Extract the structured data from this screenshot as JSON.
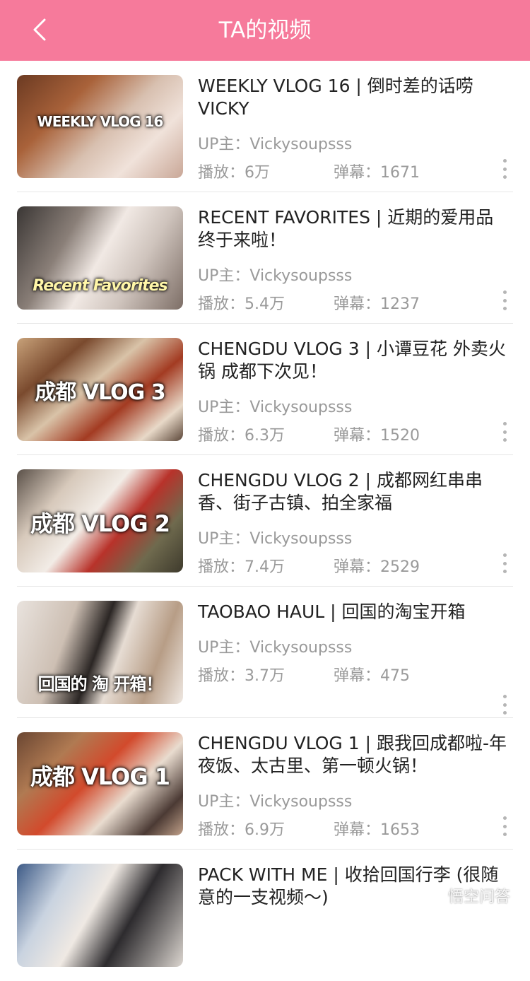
{
  "header": {
    "title": "TA的视频"
  },
  "labels": {
    "up": "UP主：",
    "play": "播放：",
    "danmu": "弹幕："
  },
  "videos": [
    {
      "title": "WEEKLY VLOG 16 | 倒时差的话唠VICKY",
      "up": "Vickysoupsss",
      "play": "6万",
      "danmu": "1671",
      "thumb_text": "WEEKLY VLOG 16"
    },
    {
      "title": "RECENT FAVORITES | 近期的爱用品终于来啦！",
      "up": "Vickysoupsss",
      "play": "5.4万",
      "danmu": "1237",
      "thumb_text": "Recent Favorites"
    },
    {
      "title": "CHENGDU VLOG 3 | 小谭豆花 外卖火锅 成都下次见！",
      "up": "Vickysoupsss",
      "play": "6.3万",
      "danmu": "1520",
      "thumb_text": "成都 VLOG 3"
    },
    {
      "title": "CHENGDU VLOG 2 | 成都网红串串香、街子古镇、拍全家福",
      "up": "Vickysoupsss",
      "play": "7.4万",
      "danmu": "2529",
      "thumb_text": "成都 VLOG 2"
    },
    {
      "title": "TAOBAO HAUL | 回国的淘宝开箱",
      "up": "Vickysoupsss",
      "play": "3.7万",
      "danmu": "475",
      "thumb_text": "回国的 淘 开箱！"
    },
    {
      "title": "CHENGDU VLOG 1 | 跟我回成都啦-年夜饭、太古里、第一顿火锅！",
      "up": "Vickysoupsss",
      "play": "6.9万",
      "danmu": "1653",
      "thumb_text": "成都 VLOG 1"
    },
    {
      "title": "PACK WITH ME | 收拾回国行李 (很随意的一支视频～)",
      "up": "",
      "play": "",
      "danmu": "",
      "thumb_text": ""
    }
  ],
  "watermark": {
    "text": "悟空问答"
  },
  "colors": {
    "header_bg": "#f67a9b",
    "title_text": "#222222",
    "meta_text": "#9a9a9a"
  }
}
